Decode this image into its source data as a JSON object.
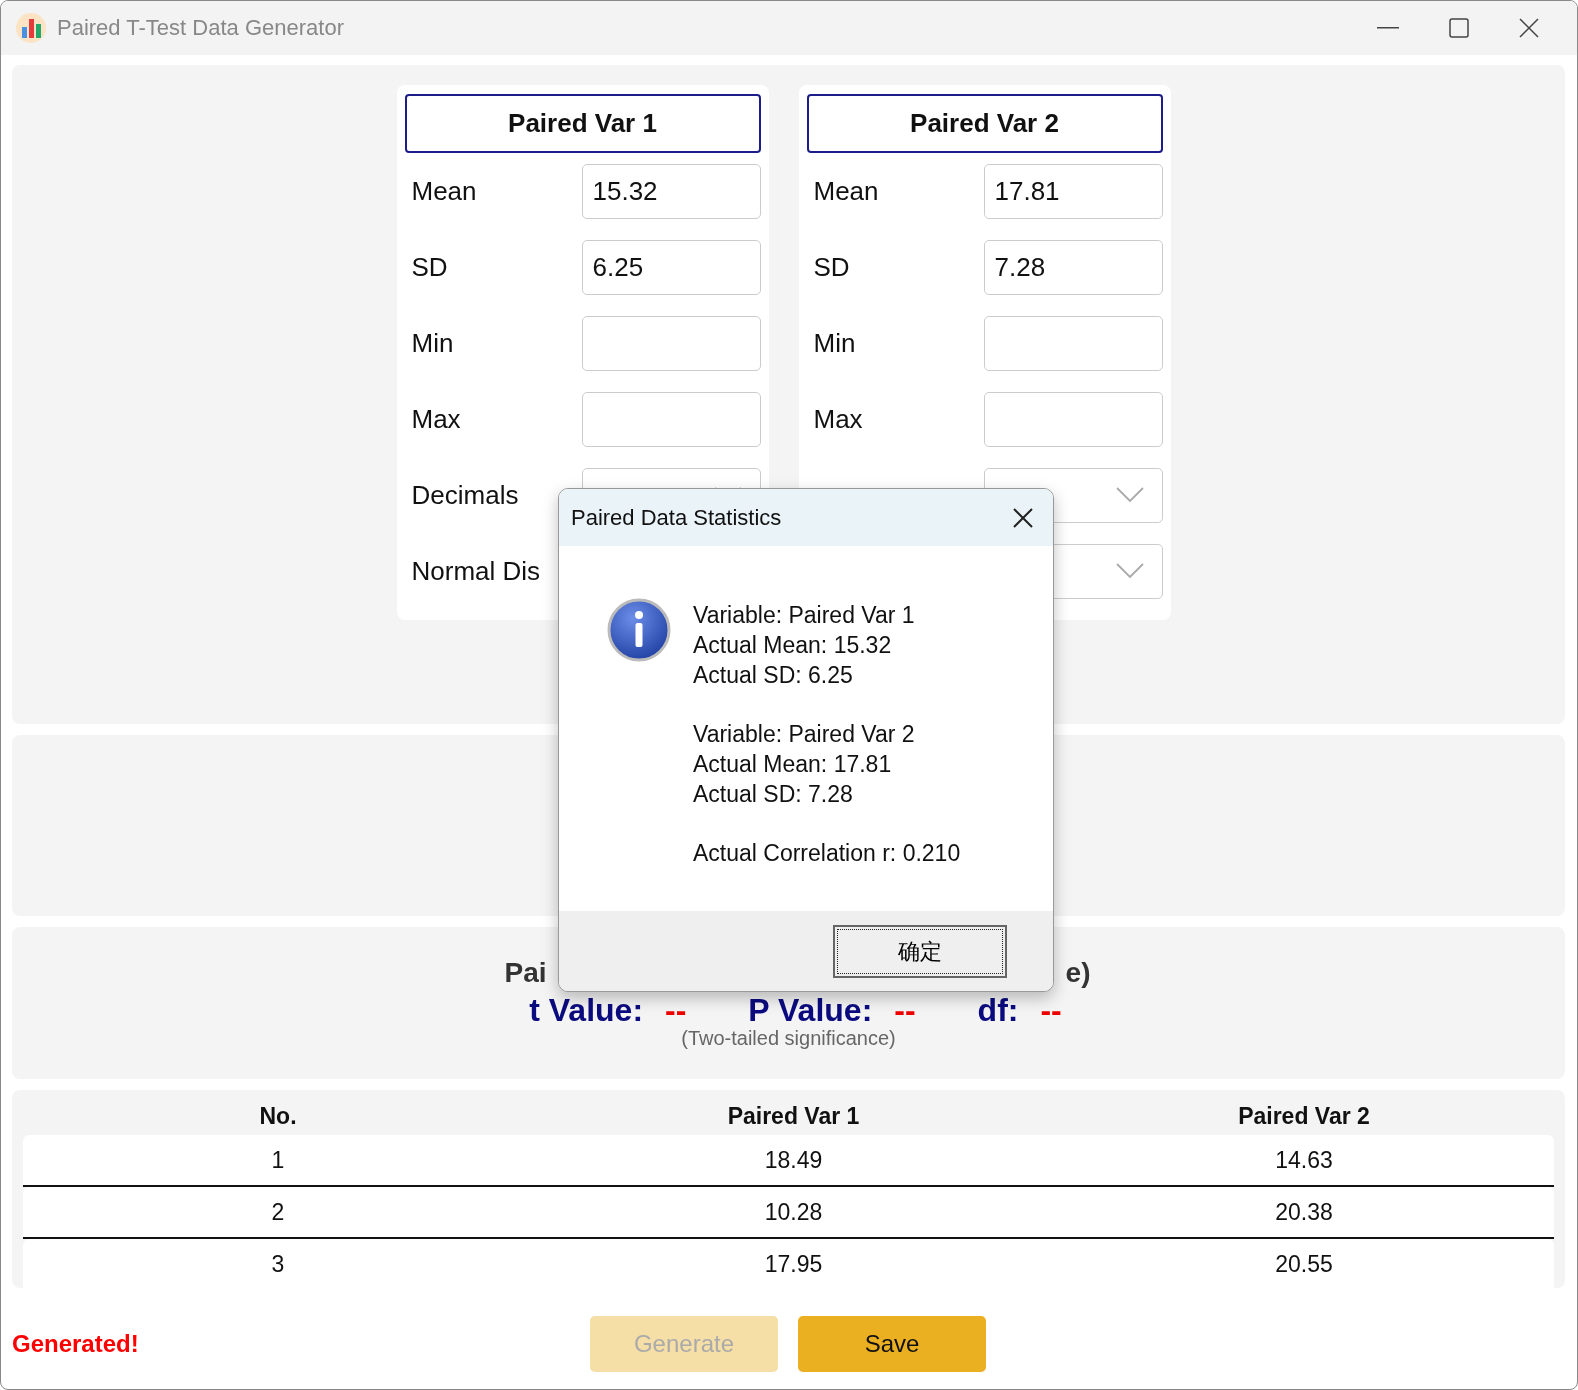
{
  "window": {
    "title": "Paired T-Test Data Generator"
  },
  "variables": [
    {
      "header": "Paired Var 1",
      "fields": [
        {
          "kind": "input",
          "label": "Mean",
          "value": "15.32"
        },
        {
          "kind": "input",
          "label": "SD",
          "value": "6.25"
        },
        {
          "kind": "input",
          "label": "Min"
        },
        {
          "kind": "input",
          "label": "Max"
        },
        {
          "kind": "select",
          "label": "Decimals"
        },
        {
          "label": "Normal Dis"
        }
      ]
    },
    {
      "header": "Paired Var 2",
      "fields": [
        {
          "kind": "input",
          "label": "Mean",
          "value": "17.81"
        },
        {
          "kind": "input",
          "label": "SD",
          "value": "7.28"
        },
        {
          "kind": "input",
          "label": "Min"
        },
        {
          "kind": "input",
          "label": "Max"
        },
        {
          "kind": "select"
        },
        {
          "kind": "select"
        }
      ]
    }
  ],
  "results": {
    "title_parts": [
      "Pai",
      "e)"
    ],
    "items": [
      {
        "label": "t Value:",
        "value": "--"
      },
      {
        "label": "P Value:",
        "value": "--"
      },
      {
        "label": "df:",
        "value": "--"
      }
    ],
    "note": "(Two-tailed significance)"
  },
  "table": {
    "columns": [
      "No.",
      "Paired Var 1",
      "Paired Var 2"
    ],
    "rows": [
      [
        "1",
        "18.49",
        "14.63"
      ],
      [
        "2",
        "10.28",
        "20.38"
      ],
      [
        "3",
        "17.95",
        "20.55"
      ]
    ]
  },
  "status": "Generated!",
  "buttons": [
    {
      "label": "Generate",
      "disabled": true
    },
    {
      "label": "Save",
      "disabled": false
    }
  ],
  "dialog": {
    "title": "Paired Data Statistics",
    "paragraphs": [
      [
        "Variable: Paired Var 1",
        "Actual Mean: 15.32",
        "Actual SD: 6.25"
      ],
      [
        "Variable: Paired Var 2",
        "Actual Mean: 17.81",
        "Actual SD: 7.28"
      ],
      [
        "Actual Correlation r: 0.210"
      ]
    ],
    "button": "确定"
  }
}
